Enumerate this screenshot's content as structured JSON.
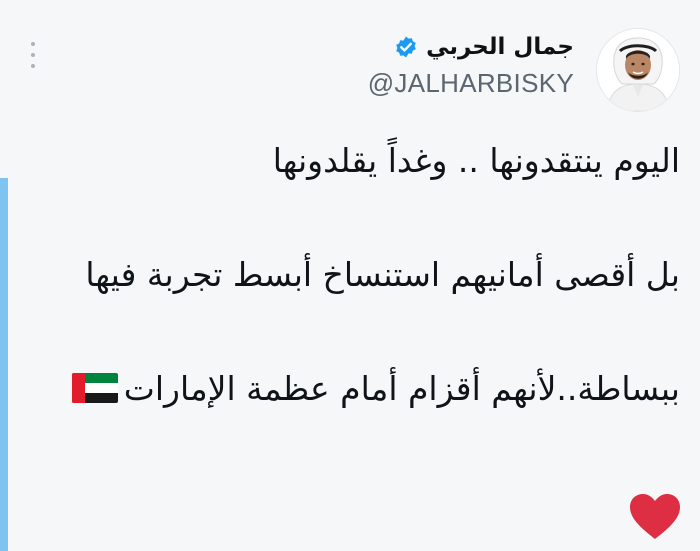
{
  "author": {
    "display_name": "جمال الحربي",
    "handle": "@JALHARBISKY",
    "verified_icon": "verified-badge-icon",
    "avatar": "profile-avatar"
  },
  "menu": {
    "icon": "more-options-icon"
  },
  "tweet": {
    "line1": "اليوم ينتقدونها .. وغداً يقلدونها",
    "line2": "بل أقصى أمانيهم استنساخ أبسط تجربة فيها",
    "line3": "ببساطة..لأنهم أقزام أمام عظمة الإمارات",
    "emoji_flag": "uae-flag-icon",
    "emoji_heart": "red-heart-icon"
  },
  "colors": {
    "verified_blue": "#1d9bf0",
    "accent_bar": "#7fc3f0",
    "flag_red": "#e21c2a",
    "flag_green": "#00843d",
    "heart_red": "#dd2e44"
  }
}
